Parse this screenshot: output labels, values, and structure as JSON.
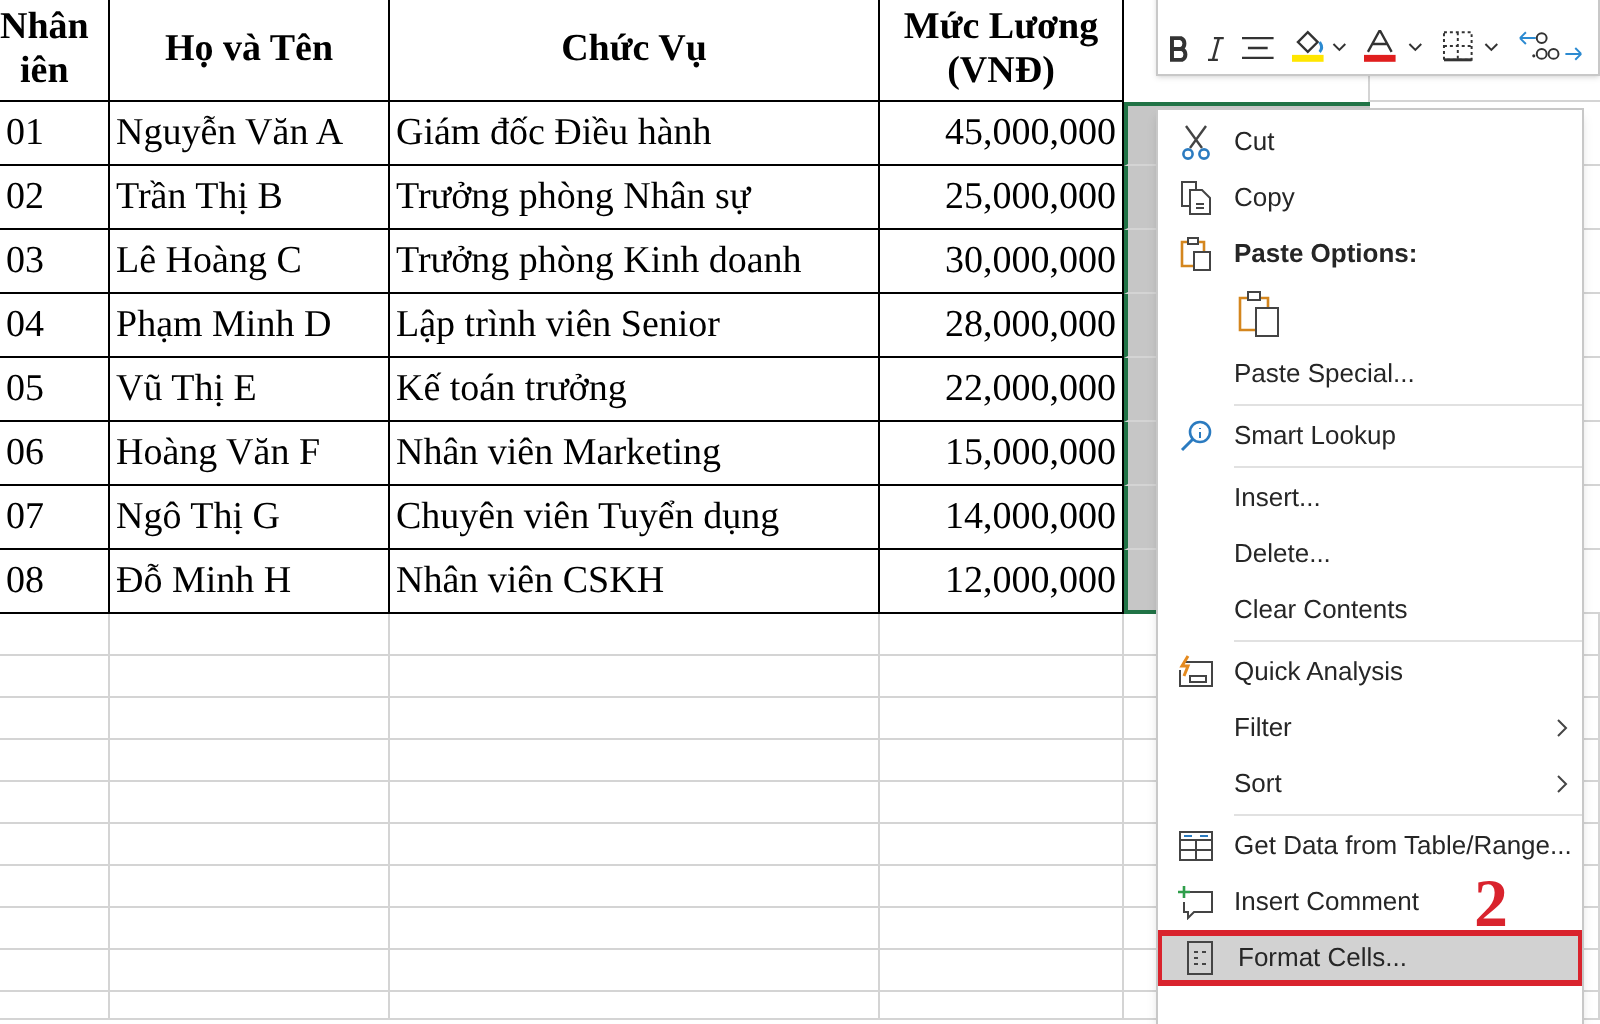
{
  "sheet": {
    "header": [
      "Nhân\niên",
      "Họ và Tên",
      "Chức Vụ",
      "Mức Lương\n(VNĐ)"
    ],
    "rows": [
      [
        "01",
        "Nguyễn Văn A",
        "Giám đốc Điều hành",
        "45,000,000"
      ],
      [
        "02",
        "Trần Thị B",
        "Trưởng phòng Nhân sự",
        "25,000,000"
      ],
      [
        "03",
        "Lê Hoàng C",
        "Trưởng phòng Kinh doanh",
        "30,000,000"
      ],
      [
        "04",
        "Phạm Minh D",
        "Lập trình viên Senior",
        "28,000,000"
      ],
      [
        "05",
        "Vũ Thị E",
        "Kế toán trưởng",
        "22,000,000"
      ],
      [
        "06",
        "Hoàng Văn F",
        "Nhân viên Marketing",
        "15,000,000"
      ],
      [
        "07",
        "Ngô Thị G",
        "Chuyên viên Tuyển dụng",
        "14,000,000"
      ],
      [
        "08",
        "Đỗ Minh H",
        "Nhân viên CSKH",
        "12,000,000"
      ]
    ]
  },
  "context_menu": {
    "groups": [
      [
        {
          "kind": "item",
          "label": "Cut"
        },
        {
          "kind": "item",
          "label": "Copy"
        },
        {
          "kind": "header",
          "label": "Paste Options:"
        },
        {
          "kind": "paste-row"
        },
        {
          "kind": "item",
          "label": "Paste Special..."
        }
      ],
      [
        {
          "kind": "item",
          "label": "Smart Lookup"
        }
      ],
      [
        {
          "kind": "item",
          "label": "Insert..."
        },
        {
          "kind": "item",
          "label": "Delete..."
        },
        {
          "kind": "item",
          "label": "Clear Contents"
        }
      ],
      [
        {
          "kind": "item",
          "label": "Quick Analysis"
        },
        {
          "kind": "item",
          "label": "Filter",
          "submenu": true
        },
        {
          "kind": "item",
          "label": "Sort",
          "submenu": true
        }
      ],
      [
        {
          "kind": "item",
          "label": "Get Data from Table/Range..."
        },
        {
          "kind": "item",
          "label": "Insert Comment"
        },
        {
          "kind": "item",
          "label": "Format Cells...",
          "selected": true
        }
      ]
    ]
  },
  "step_label": "2"
}
